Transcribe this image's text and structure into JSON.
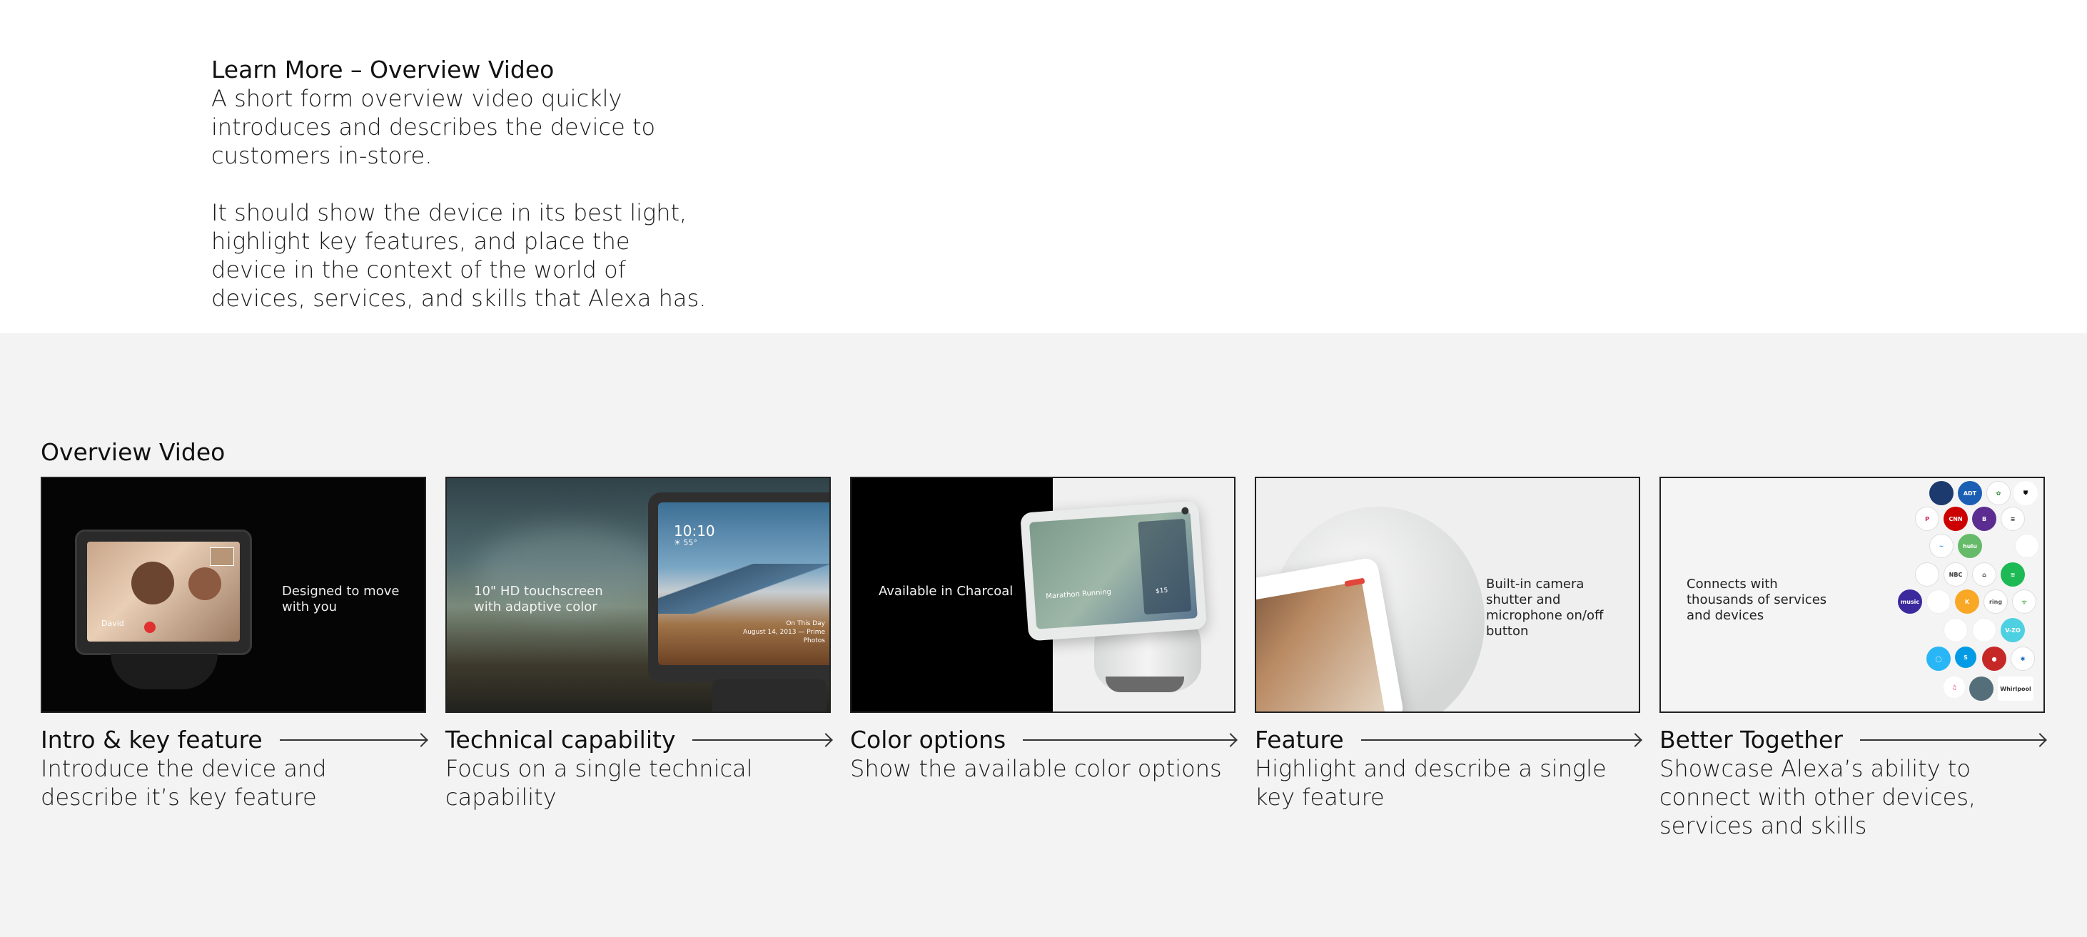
{
  "intro": {
    "title": "Learn More – Overview Video",
    "paragraph1": "A short form overview video quickly introduces and describes the device to customers in-store.",
    "paragraph2": "It should show the device in its best light, highlight key features, and place the device in the context of the world of devices, services, and skills that Alexa has."
  },
  "section": {
    "title": "Overview Video"
  },
  "cards": [
    {
      "title": "Intro & key feature",
      "description": "Introduce the device and describe it’s key feature",
      "thumb_text": "Designed to move with you",
      "thumb_call_name": "David"
    },
    {
      "title": "Technical capability",
      "description": "Focus on a single technical capability",
      "thumb_text": "10\" HD touchscreen with adaptive color",
      "thumb_clock": "10:10",
      "thumb_temp": "☀ 55°",
      "thumb_caption": "On This Day\nAugust 14, 2013 — Prime Photos"
    },
    {
      "title": "Color options",
      "description": "Show the available color options",
      "thumb_text": "Available in Charcoal",
      "thumb_screen_label": "Marathon Running",
      "thumb_price": "$15"
    },
    {
      "title": "Feature",
      "description": "Highlight and describe a single key feature",
      "thumb_text": "Built-in camera shutter and microphone on/off button"
    },
    {
      "title": "Better Together",
      "description": "Showcase Alexa’s ability to connect with other devices, services and skills",
      "thumb_text": "Connects with thousands of services and devices",
      "logo_labels": [
        "ADT",
        "CNN",
        "B",
        "hulu",
        "NBC",
        "ring",
        "V-ZO",
        "Whirlpool",
        "S",
        "music"
      ]
    }
  ],
  "colors": {
    "band_background": "#f2f3f2",
    "text": "#111111",
    "arrow": "#333333"
  }
}
